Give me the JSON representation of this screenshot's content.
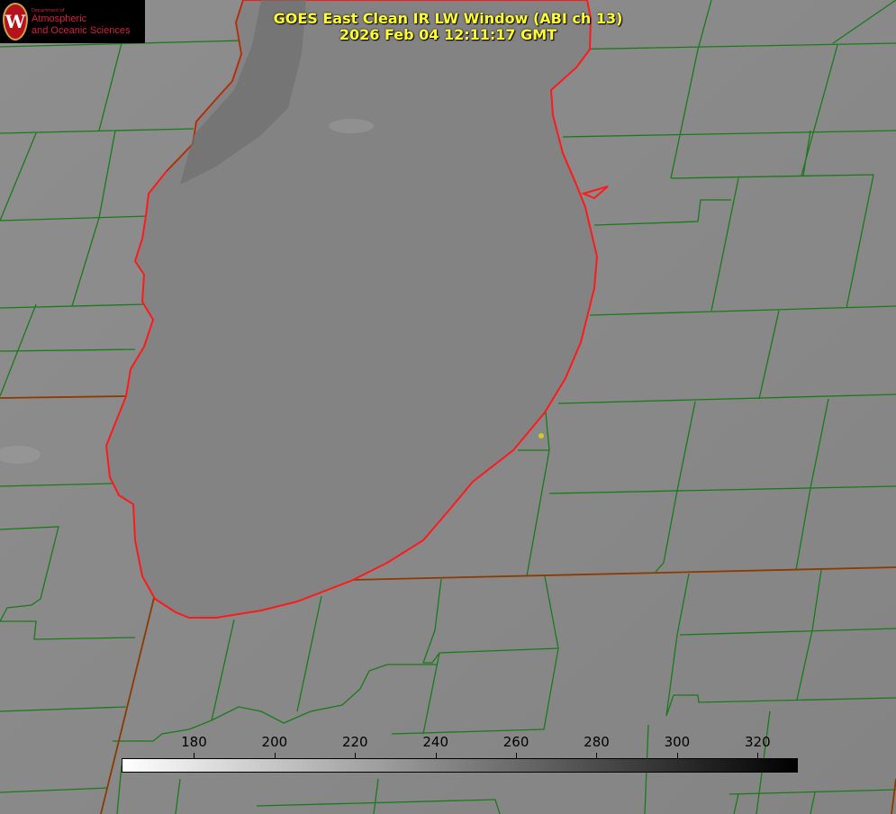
{
  "title": {
    "line1": "GOES East Clean IR LW Window (ABI ch 13)",
    "line2": "2026 Feb 04 12:11:17 GMT"
  },
  "logo": {
    "small": "Department of",
    "line1": "Atmospheric",
    "line2": "and Oceanic Sciences",
    "seal": "W"
  },
  "colorbar": {
    "min": 162,
    "max": 330,
    "ticks": [
      "180",
      "200",
      "220",
      "240",
      "260",
      "280",
      "300",
      "320"
    ],
    "tick_values": [
      180,
      200,
      220,
      240,
      260,
      280,
      300,
      320
    ],
    "colors": {
      "low": "#ffffff",
      "high": "#000000"
    }
  },
  "colors": {
    "county_lines": "#1a7a1a",
    "coastline": "#ff1a1a",
    "state_lines": "#8b3a00",
    "title": "#ffff33",
    "marker": "#cccc22"
  }
}
